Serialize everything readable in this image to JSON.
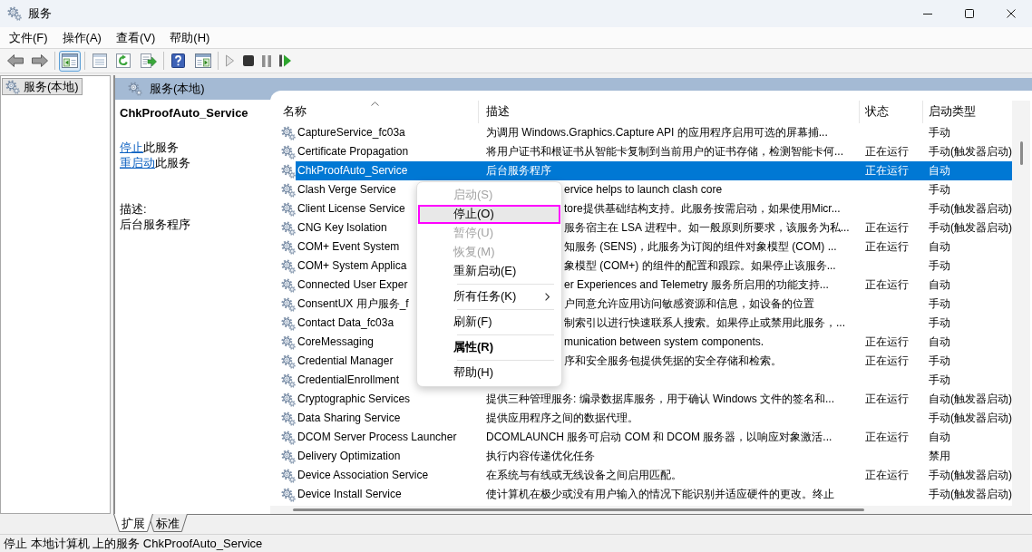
{
  "window": {
    "title": "服务"
  },
  "menu_bar": [
    "文件(F)",
    "操作(A)",
    "查看(V)",
    "帮助(H)"
  ],
  "toolbar": [
    [
      {
        "kind": "back",
        "disabled": false,
        "pressed": false
      },
      {
        "kind": "forward",
        "disabled": false,
        "pressed": false
      }
    ],
    [
      {
        "kind": "tree_toggle",
        "disabled": false,
        "pressed": true
      }
    ],
    [
      {
        "kind": "properties",
        "disabled": false,
        "pressed": false
      },
      {
        "kind": "refresh",
        "disabled": false,
        "pressed": false
      },
      {
        "kind": "export",
        "disabled": false,
        "pressed": false
      }
    ],
    [
      {
        "kind": "help",
        "disabled": false,
        "pressed": false
      },
      {
        "kind": "action_pane",
        "disabled": false,
        "pressed": false
      }
    ],
    [
      {
        "kind": "start",
        "disabled": true,
        "pressed": false
      },
      {
        "kind": "stop",
        "disabled": false,
        "pressed": false
      },
      {
        "kind": "pause",
        "disabled": true,
        "pressed": false
      },
      {
        "kind": "restart",
        "disabled": false,
        "pressed": false
      }
    ]
  ],
  "tree": [
    {
      "label": "服务(本地)",
      "selected": true
    }
  ],
  "panel": {
    "title": "服务(本地)"
  },
  "detail": {
    "service_name": "ChkProofAuto_Service",
    "actions": [
      {
        "link": "停止",
        "text": "此服务"
      },
      {
        "link": "重启动",
        "text": "此服务"
      }
    ],
    "description_label": "描述:",
    "description": "后台服务程序"
  },
  "table": {
    "columns": [
      {
        "label": "名称",
        "sorted": true
      },
      {
        "label": "描述",
        "sorted": false
      },
      {
        "label": "状态",
        "sorted": false
      },
      {
        "label": "启动类型",
        "sorted": false
      }
    ],
    "rows": [
      {
        "name": "CaptureService_fc03a",
        "description": "为调用 Windows.Graphics.Capture API 的应用程序启用可选的屏幕捕...",
        "startup_type": "手动",
        "selected": false
      },
      {
        "name": "Certificate Propagation",
        "description": "将用户证书和根证书从智能卡复制到当前用户的证书存储，检测智能卡何...",
        "status": "正在运行",
        "startup_type": "手动(触发器启动)",
        "selected": false
      },
      {
        "name": "ChkProofAuto_Service",
        "description": "后台服务程序",
        "status": "正在运行",
        "startup_type": "自动",
        "selected": true
      },
      {
        "name": "Clash Verge Service",
        "description": "ervice helps to launch clash core",
        "startup_type": "手动",
        "selected": false
      },
      {
        "name": "Client License Service",
        "description": "tore提供基础结构支持。此服务按需启动，如果使用Micr...",
        "startup_type": "手动(触发器启动)",
        "selected": false
      },
      {
        "name": "CNG Key Isolation",
        "description": "服务宿主在 LSA 进程中。如一般原则所要求，该服务为私...",
        "status": "正在运行",
        "startup_type": "手动(触发器启动)",
        "selected": false
      },
      {
        "name": "COM+ Event System",
        "description": "知服务 (SENS)，此服务为订阅的组件对象模型 (COM) ...",
        "status": "正在运行",
        "startup_type": "自动",
        "selected": false
      },
      {
        "name": "COM+ System Applica",
        "description": "象模型 (COM+) 的组件的配置和跟踪。如果停止该服务...",
        "startup_type": "手动",
        "selected": false
      },
      {
        "name": "Connected User Exper",
        "description": "er Experiences and Telemetry 服务所启用的功能支持...",
        "status": "正在运行",
        "startup_type": "自动",
        "selected": false
      },
      {
        "name": "ConsentUX 用户服务_f",
        "description": "户同意允许应用访问敏感资源和信息，如设备的位置",
        "startup_type": "手动",
        "selected": false
      },
      {
        "name": "Contact Data_fc03a",
        "description": "制索引以进行快速联系人搜索。如果停止或禁用此服务，...",
        "startup_type": "手动",
        "selected": false
      },
      {
        "name": "CoreMessaging",
        "description": "munication between system components.",
        "status": "正在运行",
        "startup_type": "自动",
        "selected": false
      },
      {
        "name": "Credential Manager",
        "description": "序和安全服务包提供凭据的安全存储和检索。",
        "status": "正在运行",
        "startup_type": "手动",
        "selected": false
      },
      {
        "name": "CredentialEnrollment",
        "startup_type": "手动",
        "selected": false
      },
      {
        "name": "Cryptographic Services",
        "description": "提供三种管理服务: 编录数据库服务，用于确认 Windows 文件的签名和...",
        "status": "正在运行",
        "startup_type": "自动(触发器启动)",
        "selected": false
      },
      {
        "name": "Data Sharing Service",
        "description": "提供应用程序之间的数据代理。",
        "startup_type": "手动(触发器启动)",
        "selected": false
      },
      {
        "name": "DCOM Server Process Launcher",
        "description": "DCOMLAUNCH 服务可启动 COM 和 DCOM 服务器，以响应对象激活...",
        "status": "正在运行",
        "startup_type": "自动",
        "selected": false
      },
      {
        "name": "Delivery Optimization",
        "description": "执行内容传递优化任务",
        "startup_type": "禁用",
        "selected": false
      },
      {
        "name": "Device Association Service",
        "description": "在系统与有线或无线设备之间启用匹配。",
        "status": "正在运行",
        "startup_type": "手动(触发器启动)",
        "selected": false
      },
      {
        "name": "Device Install Service",
        "description": "使计算机在极少或没有用户输入的情况下能识别并适应硬件的更改。终止",
        "startup_type": "手动(触发器启动)",
        "selected": false
      }
    ]
  },
  "context_menu": {
    "items": [
      {
        "kind": "item",
        "label": "启动(S)",
        "disabled": true,
        "highlighted": false,
        "outlined": false,
        "default": false,
        "submenu": false
      },
      {
        "kind": "item",
        "label": "停止(O)",
        "disabled": false,
        "highlighted": true,
        "outlined": true,
        "default": false,
        "submenu": false
      },
      {
        "kind": "item",
        "label": "暂停(U)",
        "disabled": true,
        "highlighted": false,
        "outlined": false,
        "default": false,
        "submenu": false
      },
      {
        "kind": "item",
        "label": "恢复(M)",
        "disabled": true,
        "highlighted": false,
        "outlined": false,
        "default": false,
        "submenu": false
      },
      {
        "kind": "item",
        "label": "重新启动(E)",
        "disabled": false,
        "highlighted": false,
        "outlined": false,
        "default": false,
        "submenu": false
      },
      {
        "kind": "separator"
      },
      {
        "kind": "item",
        "label": "所有任务(K)",
        "disabled": false,
        "highlighted": false,
        "outlined": false,
        "default": false,
        "submenu": true
      },
      {
        "kind": "separator"
      },
      {
        "kind": "item",
        "label": "刷新(F)",
        "disabled": false,
        "highlighted": false,
        "outlined": false,
        "default": false,
        "submenu": false
      },
      {
        "kind": "separator"
      },
      {
        "kind": "item",
        "label": "属性(R)",
        "disabled": false,
        "highlighted": false,
        "outlined": false,
        "default": true,
        "submenu": false
      },
      {
        "kind": "separator"
      },
      {
        "kind": "item",
        "label": "帮助(H)",
        "disabled": false,
        "highlighted": false,
        "outlined": false,
        "default": false,
        "submenu": false
      }
    ]
  },
  "view_tabs": [
    {
      "label": "扩展",
      "selected": true
    },
    {
      "label": "标准",
      "selected": false
    }
  ],
  "status_bar": {
    "text": "停止 本地计算机 上的服务 ChkProofAuto_Service"
  }
}
